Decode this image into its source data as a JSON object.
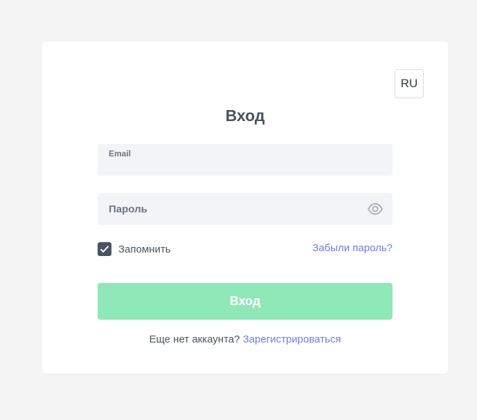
{
  "language": {
    "label": "RU"
  },
  "form": {
    "title": "Вход",
    "email": {
      "label": "Email",
      "value": ""
    },
    "password": {
      "placeholder": "Пароль",
      "value": ""
    },
    "remember": {
      "label": "Запомнить",
      "checked": true
    },
    "forgot_label": "Забыли пароль?",
    "submit_label": "Вход",
    "no_account_text": "Еще нет аккаунта?",
    "register_label": "Зарегистрироваться"
  },
  "colors": {
    "page_bg": "#f4f4f4",
    "card_bg": "#ffffff",
    "field_bg": "#f3f4f8",
    "submit_bg": "#8fe8b8",
    "link": "#6b80e0",
    "checkbox": "#4c5262",
    "text": "#4a5360"
  },
  "icons": {
    "password_toggle": "eye-icon",
    "checkbox_mark": "checkmark-icon"
  }
}
